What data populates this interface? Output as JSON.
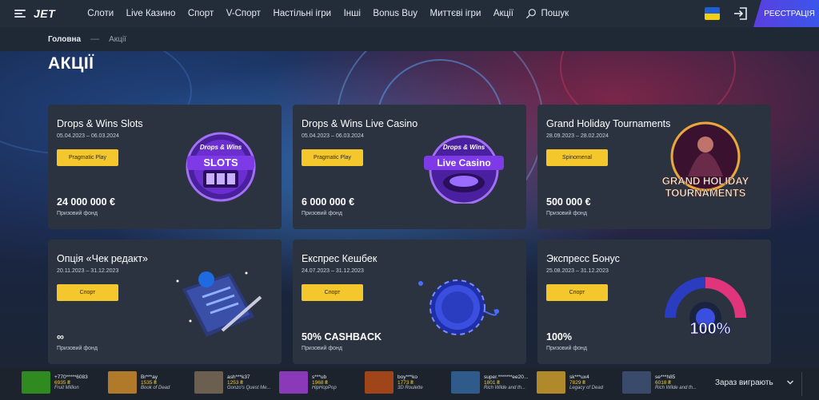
{
  "header": {
    "logo": "JET",
    "nav": [
      "Слоти",
      "Live Казино",
      "Спорт",
      "V-Спорт",
      "Настільні ігри",
      "Інші",
      "Bonus Buy",
      "Миттєві ігри",
      "Акції"
    ],
    "search_label": "Пошук",
    "register_label": "РЕЄСТРАЦІЯ"
  },
  "breadcrumb": {
    "home": "Головна",
    "current": "Акції"
  },
  "page_title": "АКЦІЇ",
  "cards": [
    {
      "title": "Drops & Wins Slots",
      "dates": "05.04.2023 – 06.03.2024",
      "provider": "Pragmatic Play",
      "amount": "24 000 000 €",
      "fund": "Призовий фонд",
      "art_top": "Drops & Wins",
      "art_main": "SLOTS"
    },
    {
      "title": "Drops & Wins Live Casino",
      "dates": "05.04.2023 – 06.03.2024",
      "provider": "Pragmatic Play",
      "amount": "6 000 000 €",
      "fund": "Призовий фонд",
      "art_top": "Drops & Wins",
      "art_main": "Live Casino"
    },
    {
      "title": "Grand Holiday Tournaments",
      "dates": "28.09.2023 – 28.02.2024",
      "provider": "Spinomenal",
      "amount": "500 000 €",
      "fund": "Призовий фонд",
      "art_top": "GRAND HOLIDAY",
      "art_main": "TOURNAMENTS"
    },
    {
      "title": "Опція «Чек редакт»",
      "dates": "20.11.2023 – 31.12.2023",
      "provider": "Спорт",
      "amount": "∞",
      "fund": "Призовий фонд"
    },
    {
      "title": "Експрес Кешбек",
      "dates": "24.07.2023 – 31.12.2023",
      "provider": "Спорт",
      "amount": "50% CASHBACK",
      "fund": "Призовий фонд"
    },
    {
      "title": "Экспресс Бонус",
      "dates": "25.08.2023 – 31.12.2023",
      "provider": "Спорт",
      "amount": "100%",
      "fund": "Призовий фонд",
      "art_main": "100%"
    }
  ],
  "winners": [
    {
      "user": "+770*****6083",
      "amount": "6935 ₴",
      "game": "Fruit Million",
      "color": "#2f8a1f"
    },
    {
      "user": "Br***ay",
      "amount": "1535 ₴",
      "game": "Book of Dead",
      "color": "#b07a2a"
    },
    {
      "user": "ash***k37",
      "amount": "1253 ₴",
      "game": "Gonzo's Quest Me...",
      "color": "#6b6050"
    },
    {
      "user": "s***ub",
      "amount": "1968 ₴",
      "game": "HipHopPop",
      "color": "#8a3ab8"
    },
    {
      "user": "boy***ko",
      "amount": "1773 ₴",
      "game": "3D Roulette",
      "color": "#a0441a"
    },
    {
      "user": "super.*******ee20...",
      "amount": "1801 ₴",
      "game": "Rich Wilde and th...",
      "color": "#2e5b8a"
    },
    {
      "user": "sk***ux4",
      "amount": "7829 ₴",
      "game": "Legacy of Dead",
      "color": "#b08a2a"
    },
    {
      "user": "se***h85",
      "amount": "6018 ₴",
      "game": "Rich Wilde and th...",
      "color": "#3a4a6a"
    }
  ],
  "winning_now_label": "Зараз виграють",
  "colors": {
    "accent_yellow": "#f4c82c",
    "register_start": "#5b3fe0",
    "register_end": "#3a56ea",
    "card_bg": "#2a333f"
  },
  "icons": [
    "menu-icon",
    "search-icon",
    "ukraine-flag-icon",
    "login-icon",
    "chevron-down-icon"
  ]
}
